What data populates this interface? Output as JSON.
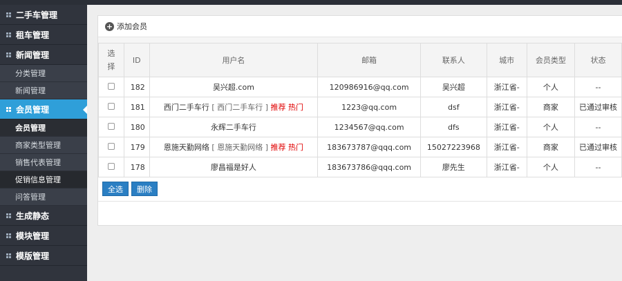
{
  "sidebar": {
    "groups": [
      {
        "label": "二手车管理"
      },
      {
        "label": "租车管理"
      },
      {
        "label": "新闻管理"
      },
      {
        "label": "会员管理"
      },
      {
        "label": "生成静态"
      },
      {
        "label": "模块管理"
      },
      {
        "label": "模版管理"
      }
    ],
    "news_subs": [
      {
        "label": "分类管理"
      },
      {
        "label": "新闻管理"
      }
    ],
    "member_subs": [
      {
        "label": "会员管理"
      },
      {
        "label": "商家类型管理"
      },
      {
        "label": "销售代表管理"
      },
      {
        "label": "促销信息管理"
      },
      {
        "label": "问答管理"
      }
    ]
  },
  "toolbar": {
    "add_label": "添加会员"
  },
  "table": {
    "headers": [
      "选择",
      "ID",
      "用户名",
      "邮箱",
      "联系人",
      "城市",
      "会员类型",
      "状态"
    ],
    "rows": [
      {
        "id": "182",
        "username": "吴兴超.com",
        "username_suffix": "",
        "tags": "",
        "email": "120986916@qq.com",
        "contact": "吴兴超",
        "city": "浙江省-",
        "type": "个人",
        "status": "--"
      },
      {
        "id": "181",
        "username": "西门二手车行",
        "username_suffix": "[ 西门二手车行 ]",
        "tags": "推荐 热门",
        "email": "1223@qq.com",
        "contact": "dsf",
        "city": "浙江省-",
        "type": "商家",
        "status": "已通过审核"
      },
      {
        "id": "180",
        "username": "永辉二手车行",
        "username_suffix": "",
        "tags": "",
        "email": "1234567@qq.com",
        "contact": "dfs",
        "city": "浙江省-",
        "type": "个人",
        "status": "--"
      },
      {
        "id": "179",
        "username": "恩施天勤网络",
        "username_suffix": "[ 恩施天勤网络 ]",
        "tags": "推荐 热门",
        "email": "183673787@qqq.com",
        "contact": "15027223968",
        "city": "浙江省-",
        "type": "商家",
        "status": "已通过审核"
      },
      {
        "id": "178",
        "username": "廖昌福是好人",
        "username_suffix": "",
        "tags": "",
        "email": "183673786@qqq.com",
        "contact": "廖先生",
        "city": "浙江省-",
        "type": "个人",
        "status": "--"
      }
    ]
  },
  "buttons": {
    "select_all": "全选",
    "delete": "删除"
  }
}
